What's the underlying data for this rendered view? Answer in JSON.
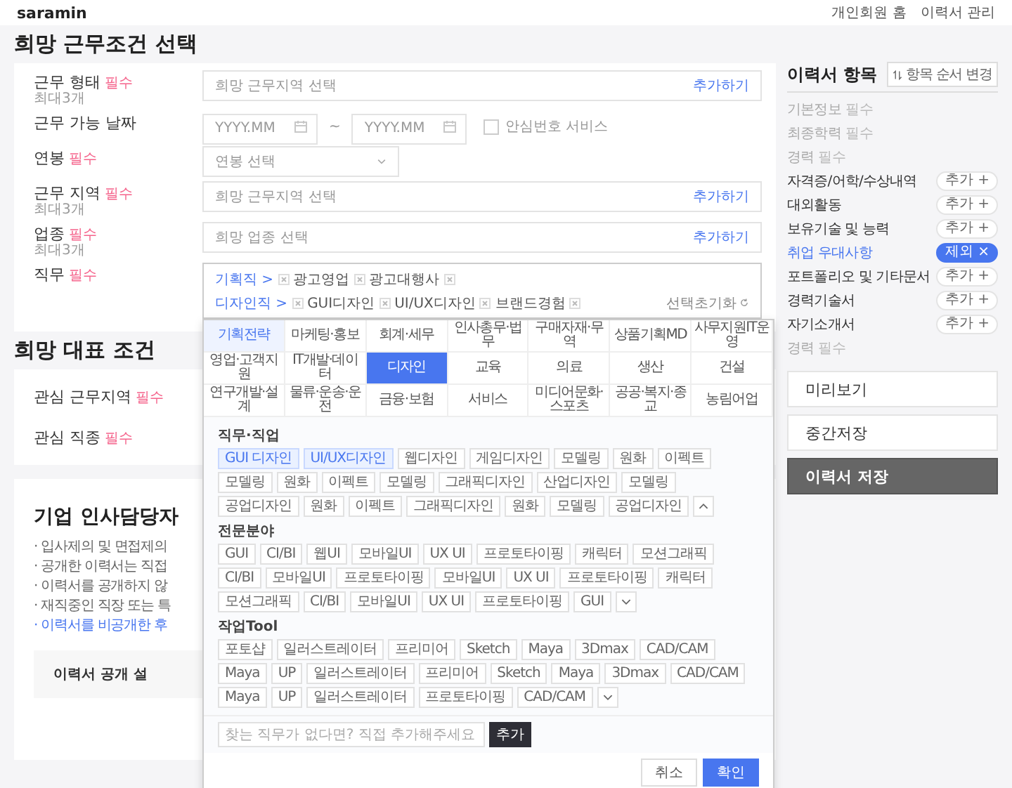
{
  "header": {
    "logo": "saramin",
    "links": [
      "개인회원 홈",
      "이력서 관리"
    ]
  },
  "conditions": {
    "title": "희망 근무조건 선택",
    "rows": [
      {
        "kind": "picker",
        "label": "근무 형태",
        "required": "필수",
        "note": "최대3개",
        "placeholder": "희망 근무지역 선택",
        "action": "추가하기"
      },
      {
        "kind": "dates",
        "label": "근무 가능 날짜",
        "from": {
          "placeholder": "YYYY.MM"
        },
        "separator": "~",
        "to": {
          "placeholder": "YYYY.MM"
        },
        "option": {
          "label": "안심번호 서비스",
          "checked": false
        }
      },
      {
        "kind": "select",
        "label": "연봉",
        "required": "필수",
        "placeholder": "연봉 선택"
      },
      {
        "kind": "picker",
        "label": "근무 지역",
        "required": "필수",
        "note": "최대3개",
        "placeholder": "희망 근무지역 선택",
        "action": "추가하기"
      },
      {
        "kind": "picker",
        "label": "업종",
        "required": "필수",
        "note": "최대3개",
        "placeholder": "희망 업종 선택",
        "action": "추가하기"
      },
      {
        "kind": "jobs",
        "label": "직무",
        "required": "필수",
        "groups": [
          {
            "category": "기획직 >",
            "items": [
              "광고영업",
              "광고대행사"
            ]
          },
          {
            "category": "디자인직 >",
            "items": [
              "GUI디자인",
              "UI/UX디자인",
              "브랜드경험"
            ]
          }
        ],
        "reset": "선택초기화"
      }
    ]
  },
  "representative": {
    "title": "희망 대표 조건",
    "rows": [
      {
        "label": "관심 근무지역",
        "required": "필수"
      },
      {
        "label": "관심 직종",
        "required": "필수"
      }
    ]
  },
  "hr_notice": {
    "title": "기업 인사담당자",
    "lines": [
      {
        "text": "· 입사제의 및 면접제의",
        "kind": "plain"
      },
      {
        "text": "· 공개한 이력서는 직접",
        "kind": "plain"
      },
      {
        "text": "· 이력서를 공개하지 않",
        "kind": "plain"
      },
      {
        "text": "· 재직중인 직장 또는 특",
        "kind": "plain"
      },
      {
        "text": "· 이력서를 비공개한 후",
        "kind": "link"
      }
    ],
    "button": "이력서 공개 설"
  },
  "dropdown": {
    "categories": [
      {
        "label": "기획전략",
        "selected": false,
        "highlighted": true
      },
      {
        "label": "마케팅·홍보",
        "selected": false,
        "highlighted": false
      },
      {
        "label": "회계·세무",
        "selected": false,
        "highlighted": false
      },
      {
        "label": "인사총무·법무",
        "selected": false,
        "highlighted": false
      },
      {
        "label": "구매자재·무역",
        "selected": false,
        "highlighted": false
      },
      {
        "label": "상품기획MD",
        "selected": false,
        "highlighted": false
      },
      {
        "label": "사무지원IT운영",
        "selected": false,
        "highlighted": false
      },
      {
        "label": "영업·고객지원",
        "selected": false,
        "highlighted": false
      },
      {
        "label": "IT개발·데이터",
        "selected": false,
        "highlighted": false
      },
      {
        "label": "디자인",
        "selected": true,
        "highlighted": false
      },
      {
        "label": "교육",
        "selected": false,
        "highlighted": false
      },
      {
        "label": "의료",
        "selected": false,
        "highlighted": false
      },
      {
        "label": "생산",
        "selected": false,
        "highlighted": false
      },
      {
        "label": "건설",
        "selected": false,
        "highlighted": false
      },
      {
        "label": "연구개발·설계",
        "selected": false,
        "highlighted": false
      },
      {
        "label": "물류·운송·운전",
        "selected": false,
        "highlighted": false
      },
      {
        "label": "금융·보험",
        "selected": false,
        "highlighted": false
      },
      {
        "label": "서비스",
        "selected": false,
        "highlighted": false
      },
      {
        "label": "미디어문화·스포츠",
        "selected": false,
        "highlighted": false
      },
      {
        "label": "공공·복지·종교",
        "selected": false,
        "highlighted": false
      },
      {
        "label": "농림어업",
        "selected": false,
        "highlighted": false
      }
    ],
    "sections": [
      {
        "title": "직무·직업",
        "expanded": true,
        "tags": [
          {
            "label": "GUI 디자인",
            "selected": true
          },
          {
            "label": "UI/UX디자인",
            "selected": true
          },
          {
            "label": "웹디자인",
            "selected": false
          },
          {
            "label": "게임디자인",
            "selected": false
          },
          {
            "label": "모델링",
            "selected": false
          },
          {
            "label": "원화",
            "selected": false
          },
          {
            "label": "이펙트",
            "selected": false
          },
          {
            "label": "모델링",
            "selected": false
          },
          {
            "label": "원화",
            "selected": false
          },
          {
            "label": "이펙트",
            "selected": false
          },
          {
            "label": "모델링",
            "selected": false
          },
          {
            "label": "그래픽디자인",
            "selected": false
          },
          {
            "label": "산업디자인",
            "selected": false
          },
          {
            "label": "모델링",
            "selected": false
          },
          {
            "label": "공업디자인",
            "selected": false
          },
          {
            "label": "원화",
            "selected": false
          },
          {
            "label": "이펙트",
            "selected": false
          },
          {
            "label": "그래픽디자인",
            "selected": false
          },
          {
            "label": "원화",
            "selected": false
          },
          {
            "label": "모델링",
            "selected": false
          },
          {
            "label": "공업디자인",
            "selected": false
          }
        ]
      },
      {
        "title": "전문분야",
        "expanded": false,
        "tags": [
          {
            "label": "GUI",
            "selected": false
          },
          {
            "label": "CI/BI",
            "selected": false
          },
          {
            "label": "웹UI",
            "selected": false
          },
          {
            "label": "모바일UI",
            "selected": false
          },
          {
            "label": "UX UI",
            "selected": false
          },
          {
            "label": "프로토타이핑",
            "selected": false
          },
          {
            "label": "캐릭터",
            "selected": false
          },
          {
            "label": "모션그래픽",
            "selected": false
          },
          {
            "label": "CI/BI",
            "selected": false
          },
          {
            "label": "모바일UI",
            "selected": false
          },
          {
            "label": "프로토타이핑",
            "selected": false
          },
          {
            "label": "모바일UI",
            "selected": false
          },
          {
            "label": "UX UI",
            "selected": false
          },
          {
            "label": "프로토타이핑",
            "selected": false
          },
          {
            "label": "캐릭터",
            "selected": false
          },
          {
            "label": "모션그래픽",
            "selected": false
          },
          {
            "label": "CI/BI",
            "selected": false
          },
          {
            "label": "모바일UI",
            "selected": false
          },
          {
            "label": "UX UI",
            "selected": false
          },
          {
            "label": "프로토타이핑",
            "selected": false
          },
          {
            "label": "GUI",
            "selected": false
          }
        ]
      },
      {
        "title": "작업Tool",
        "expanded": false,
        "tags": [
          {
            "label": "포토샵",
            "selected": false
          },
          {
            "label": "일러스트레이터",
            "selected": false
          },
          {
            "label": "프리미어",
            "selected": false
          },
          {
            "label": "Sketch",
            "selected": false
          },
          {
            "label": "Maya",
            "selected": false
          },
          {
            "label": "3Dmax",
            "selected": false
          },
          {
            "label": "CAD/CAM",
            "selected": false
          },
          {
            "label": "Maya",
            "selected": false
          },
          {
            "label": "UP",
            "selected": false
          },
          {
            "label": "일러스트레이터",
            "selected": false
          },
          {
            "label": "프리미어",
            "selected": false
          },
          {
            "label": "Sketch",
            "selected": false
          },
          {
            "label": "Maya",
            "selected": false
          },
          {
            "label": "3Dmax",
            "selected": false
          },
          {
            "label": "CAD/CAM",
            "selected": false
          },
          {
            "label": "Maya",
            "selected": false
          },
          {
            "label": "UP",
            "selected": false
          },
          {
            "label": "일러스트레이터",
            "selected": false
          },
          {
            "label": "프로토타이핑",
            "selected": false
          },
          {
            "label": "CAD/CAM",
            "selected": false
          }
        ]
      }
    ],
    "custom": {
      "placeholder": "찾는 직무가 없다면? 직접 추가해주세요",
      "button": "추가"
    },
    "buttons": [
      {
        "label": "취소",
        "kind": "secondary"
      },
      {
        "label": "확인",
        "kind": "primary"
      }
    ]
  },
  "sidebar": {
    "title": "이력서 항목",
    "reorder": "항목 순서 변경",
    "items": [
      {
        "kind": "required",
        "label": "기본정보",
        "badge": "필수"
      },
      {
        "kind": "required",
        "label": "최종학력",
        "badge": "필수"
      },
      {
        "kind": "required",
        "label": "경력",
        "badge": "필수"
      },
      {
        "kind": "optional",
        "label": "자격증/어학/수상내역",
        "action": "추가 +"
      },
      {
        "kind": "optional",
        "label": "대외활동",
        "action": "추가 +"
      },
      {
        "kind": "optional",
        "label": "보유기술 및 능력",
        "action": "추가 +"
      },
      {
        "kind": "added",
        "label": "취업 우대사항",
        "action": "제외 ×"
      },
      {
        "kind": "optional",
        "label": "포트폴리오 및 기타문서",
        "action": "추가 +"
      },
      {
        "kind": "optional",
        "label": "경력기술서",
        "action": "추가 +"
      },
      {
        "kind": "optional",
        "label": "자기소개서",
        "action": "추가 +"
      },
      {
        "kind": "required",
        "label": "경력",
        "badge": "필수"
      }
    ],
    "buttons": [
      {
        "label": "미리보기",
        "kind": "secondary"
      },
      {
        "label": "중간저장",
        "kind": "secondary"
      },
      {
        "label": "이력서 저장",
        "kind": "primary"
      }
    ]
  }
}
